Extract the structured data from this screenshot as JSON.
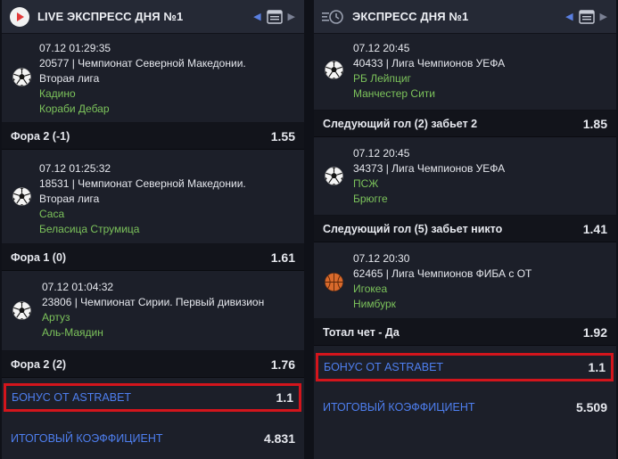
{
  "colors": {
    "accent": "#4e7ff0",
    "team": "#7cc35b",
    "highlight": "#d3151c"
  },
  "left": {
    "title": "LIVE ЭКСПРЕСС ДНЯ №1",
    "events": [
      {
        "datetime": "07.12  01:29:35",
        "league_line1": "20577 | Чемпионат Северной Македонии.",
        "league_line2": "Вторая лига",
        "team1": "Кадино",
        "team2": "Кораби Дебар",
        "bet_label": "Фора 2 (-1)",
        "bet_value": "1.55",
        "icon": "soccer-ball-icon"
      },
      {
        "datetime": "07.12  01:25:32",
        "league_line1": "18531 | Чемпионат Северной Македонии.",
        "league_line2": "Вторая лига",
        "team1": "Саса",
        "team2": "Беласица Струмица",
        "bet_label": "Фора 1 (0)",
        "bet_value": "1.61",
        "icon": "soccer-ball-icon"
      },
      {
        "datetime": "07.12  01:04:32",
        "league_line1": "23806 | Чемпионат Сирии. Первый дивизион",
        "team1": "Артуз",
        "team2": "Аль-Маядин",
        "bet_label": "Фора 2 (2)",
        "bet_value": "1.76",
        "icon": "soccer-ball-icon"
      }
    ],
    "bonus_label": "БОНУС ОТ ASTRABET",
    "bonus_value": "1.1",
    "total_label": "ИТОГОВЫЙ КОЭФФИЦИЕНТ",
    "total_value": "4.831"
  },
  "right": {
    "title": "ЭКСПРЕСС ДНЯ №1",
    "events": [
      {
        "datetime": "07.12  20:45",
        "league_line1": "40433 | Лига Чемпионов УЕФА",
        "team1": "РБ Лейпциг",
        "team2": "Манчестер Сити",
        "bet_label": "Следующий гол (2) забьет 2",
        "bet_value": "1.85",
        "icon": "soccer-ball-icon"
      },
      {
        "datetime": "07.12  20:45",
        "league_line1": "34373 | Лига Чемпионов УЕФА",
        "team1": "ПСЖ",
        "team2": "Брюгге",
        "bet_label": "Следующий гол (5) забьет никто",
        "bet_value": "1.41",
        "icon": "soccer-ball-icon"
      },
      {
        "datetime": "07.12  20:30",
        "league_line1": "62465 | Лига Чемпионов ФИБА с ОТ",
        "team1": "Игокеа",
        "team2": "Нимбурк",
        "bet_label": "Тотал чет - Да",
        "bet_value": "1.92",
        "icon": "basketball-icon"
      }
    ],
    "bonus_label": "БОНУС ОТ ASTRABET",
    "bonus_value": "1.1",
    "total_label": "ИТОГОВЫЙ КОЭФФИЦИЕНТ",
    "total_value": "5.509"
  }
}
